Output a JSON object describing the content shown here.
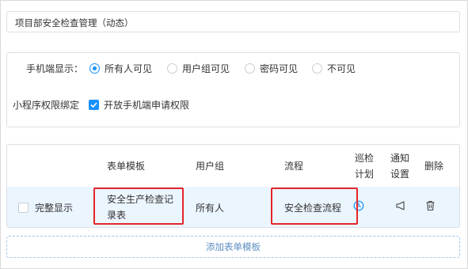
{
  "title_field": {
    "value": "项目部安全检查管理（动态）"
  },
  "mobile_display": {
    "label": "手机端显示：",
    "options": [
      "所有人可见",
      "用户组可见",
      "密码可见",
      "不可见"
    ],
    "selected": "所有人可见"
  },
  "miniprogram": {
    "label": "小程序权限绑定",
    "checkbox_label": "开放手机端申请权限",
    "checked": true
  },
  "table": {
    "headers": {
      "form_template": "表单模板",
      "user_group": "用户组",
      "process": "流程",
      "patrol_plan_1": "巡检",
      "patrol_plan_2": "计划",
      "notify_1": "通知",
      "notify_2": "设置",
      "delete": "删除"
    },
    "rows": [
      {
        "full_display_label": "完整显示",
        "full_display_checked": false,
        "form_template_line1": "安全生产检查记",
        "form_template_line2": "录表",
        "user_group": "所有人",
        "process": "安全检查流程"
      }
    ]
  },
  "add_template_label": "添加表单模板",
  "colors": {
    "accent": "#1890ff",
    "highlight_border": "#e5252a",
    "row_bg": "#ebf5fe",
    "add_text": "#5c8fc4"
  }
}
